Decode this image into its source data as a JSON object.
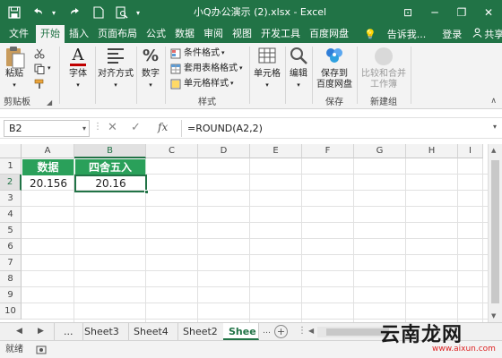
{
  "window": {
    "title": "小Q办公演示 (2).xlsx - Excel",
    "minimize": "─",
    "restore": "❐",
    "close": "✕",
    "ribbon_display": "⊡"
  },
  "quick_access": {
    "save_icon": "save-icon",
    "undo_icon": "undo-icon",
    "redo_icon": "redo-icon",
    "new_icon": "new-file-icon",
    "preview_icon": "print-preview-icon"
  },
  "tabs": [
    {
      "label": "文件",
      "active": false
    },
    {
      "label": "开始",
      "active": true
    },
    {
      "label": "插入",
      "active": false
    },
    {
      "label": "页面布局",
      "active": false
    },
    {
      "label": "公式",
      "active": false
    },
    {
      "label": "数据",
      "active": false
    },
    {
      "label": "审阅",
      "active": false
    },
    {
      "label": "视图",
      "active": false
    },
    {
      "label": "开发工具",
      "active": false
    },
    {
      "label": "百度网盘",
      "active": false
    }
  ],
  "tell_me": "告诉我...",
  "login": "登录",
  "share": "共享",
  "ribbon": {
    "clipboard": {
      "paste": "粘贴",
      "label": "剪贴板"
    },
    "font": {
      "button": "字体",
      "glyph": "A"
    },
    "alignment": {
      "button": "对齐方式"
    },
    "number": {
      "button": "数字",
      "glyph": "%"
    },
    "styles": {
      "conditional": "条件格式",
      "table": "套用表格格式",
      "cell": "单元格样式",
      "label": "样式"
    },
    "cells": {
      "button": "单元格"
    },
    "editing": {
      "button": "编辑"
    },
    "save": {
      "button_line1": "保存到",
      "button_line2": "百度网盘",
      "label": "保存"
    },
    "new_group": {
      "button_line1": "比较和合并",
      "button_line2": "工作簿",
      "label": "新建组"
    }
  },
  "formula_bar": {
    "name_box": "B2",
    "cancel": "✕",
    "enter": "✓",
    "fx": "fx",
    "formula": "=ROUND(A2,2)"
  },
  "grid": {
    "columns": [
      "A",
      "B",
      "C",
      "D",
      "E",
      "F",
      "G",
      "H",
      "I"
    ],
    "rows": [
      "1",
      "2",
      "3",
      "4",
      "5",
      "6",
      "7",
      "8",
      "9",
      "10"
    ],
    "cells": {
      "A1": "数据",
      "B1": "四舍五入",
      "A2": "20.156",
      "B2": "20.16"
    },
    "header_fill": "#2aa05a",
    "accent": "#217346"
  },
  "sheets": {
    "more": "...",
    "items": [
      "Sheet3",
      "Sheet4",
      "Sheet2",
      "Shee"
    ],
    "active_index": 3,
    "add": "+"
  },
  "status": {
    "text": "就绪"
  },
  "watermark": {
    "text": "云南龙网",
    "url": "www.aixun.com"
  }
}
